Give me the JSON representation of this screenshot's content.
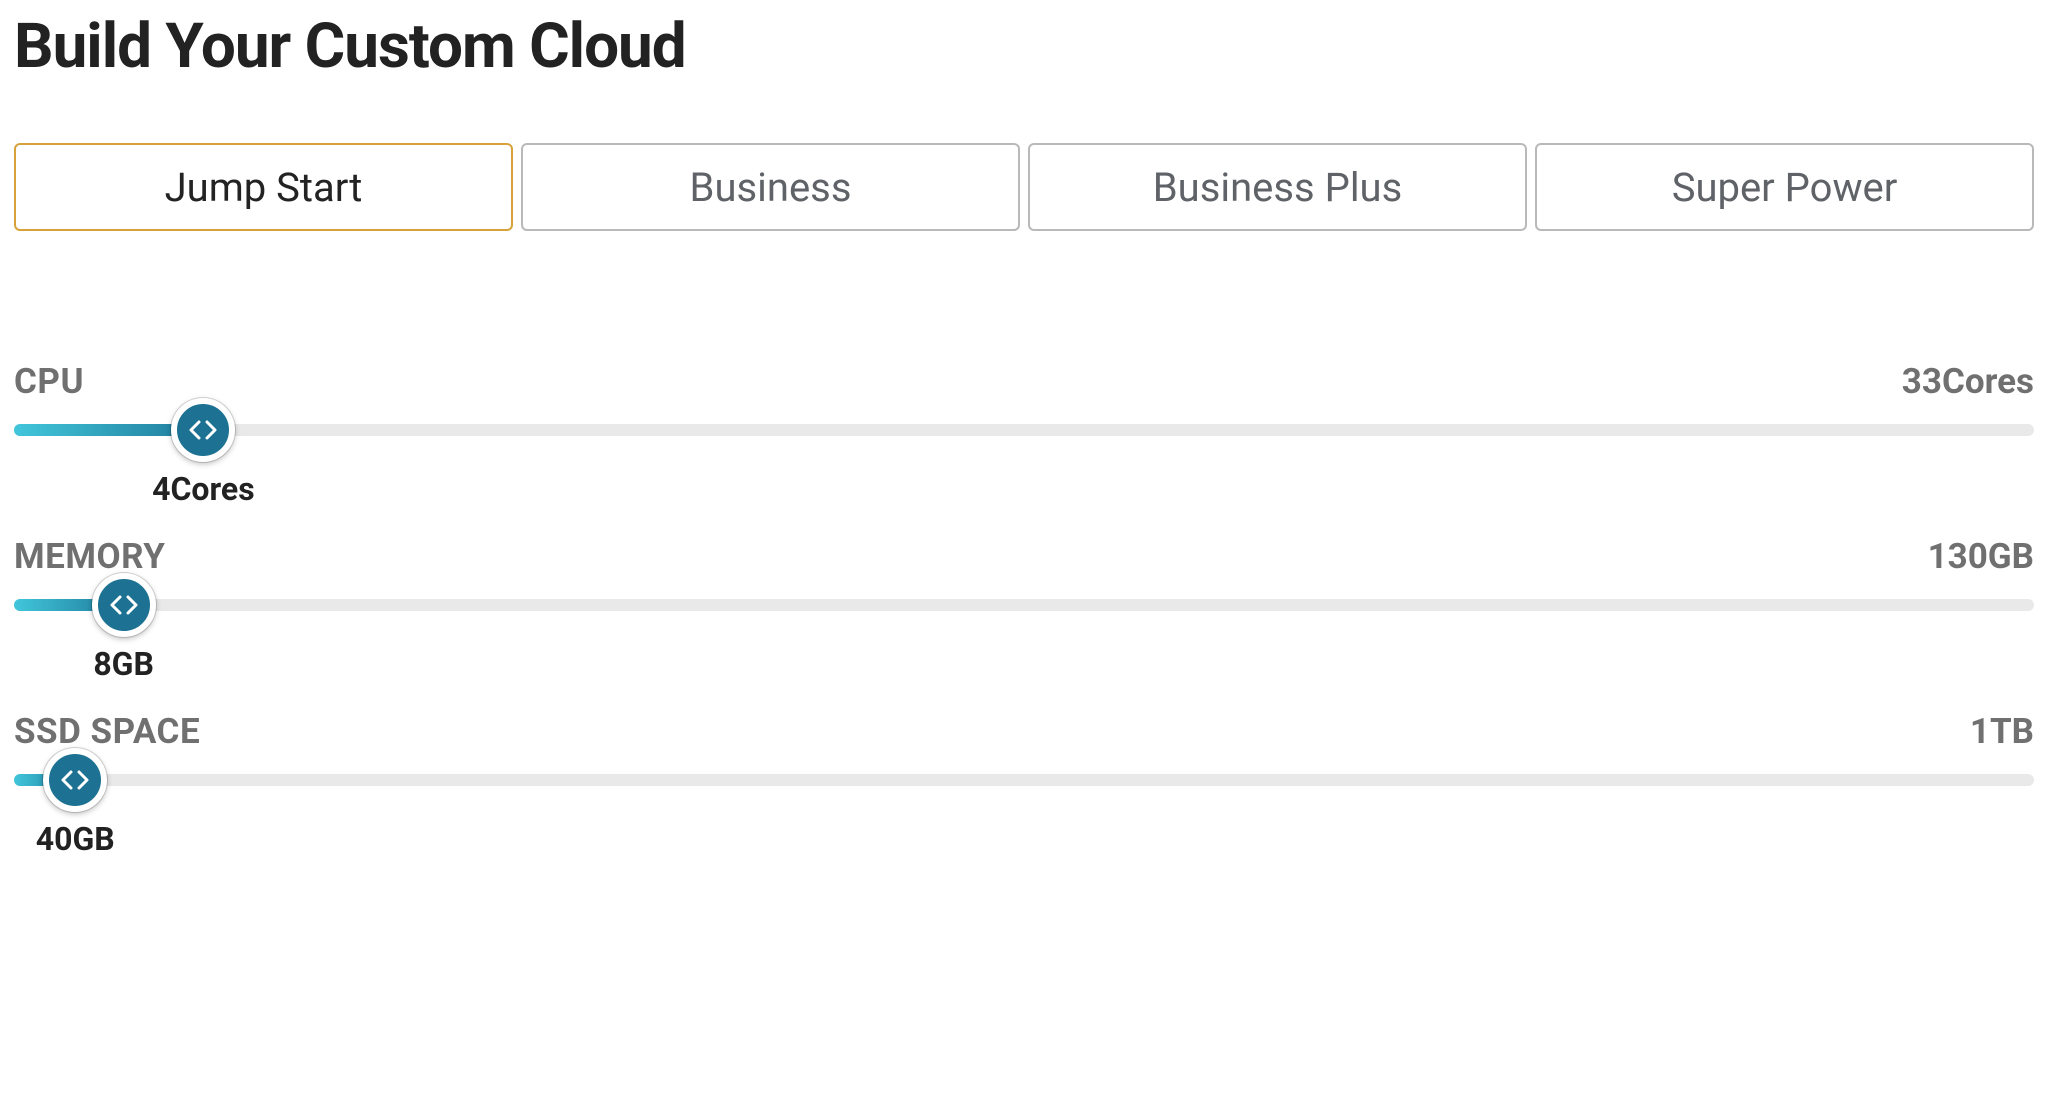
{
  "title": "Build Your Custom Cloud",
  "tabs": [
    {
      "id": "jump-start",
      "label": "Jump Start",
      "active": true
    },
    {
      "id": "business",
      "label": "Business",
      "active": false
    },
    {
      "id": "business-plus",
      "label": "Business Plus",
      "active": false
    },
    {
      "id": "super-power",
      "label": "Super Power",
      "active": false
    }
  ],
  "sliders": {
    "cpu": {
      "label": "CPU",
      "min": 1,
      "max": 33,
      "unit": "Cores",
      "value": 4,
      "max_display": "33Cores",
      "value_display": "4Cores"
    },
    "memory": {
      "label": "MEMORY",
      "min": 1,
      "max": 130,
      "unit": "GB",
      "value": 8,
      "max_display": "130GB",
      "value_display": "8GB"
    },
    "ssd": {
      "label": "SSD SPACE",
      "min": 10,
      "max": 1000,
      "unit": "GB",
      "value": 40,
      "max_display": "1TB",
      "value_display": "40GB"
    }
  }
}
